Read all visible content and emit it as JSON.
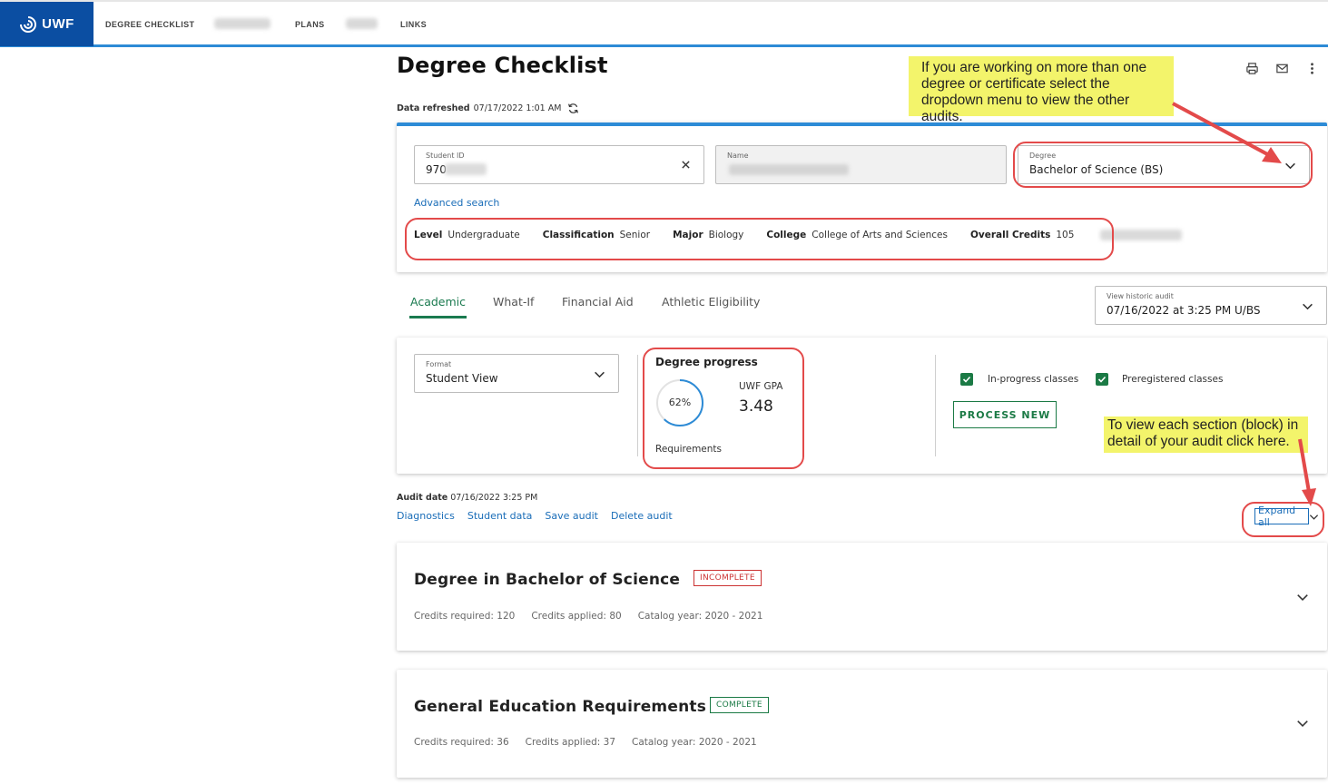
{
  "brand": {
    "logo_text": "UWF",
    "primary": "#0b4ea2",
    "accent": "#2d8bd6",
    "success": "#1b7a45",
    "danger": "#cc3333",
    "annotation": "#e34a4a",
    "callout": "#f3f46b"
  },
  "nav": {
    "items": [
      "DEGREE CHECKLIST",
      "PLANS",
      "LINKS"
    ]
  },
  "page": {
    "title": "Degree Checklist",
    "refreshed_label": "Data refreshed",
    "refreshed_value": "07/17/2022 1:01 AM"
  },
  "callouts": {
    "degree_menu": "If you are working on more than one degree or certificate select the dropdown menu to view the other audits.",
    "expand_all": "To view each section (block) in detail of your audit click here."
  },
  "student": {
    "id_label": "Student ID",
    "id_value": "970",
    "name_label": "Name",
    "degree_label": "Degree",
    "degree_value": "Bachelor of Science (BS)",
    "advanced_search": "Advanced search",
    "info": [
      {
        "label": "Level",
        "value": "Undergraduate"
      },
      {
        "label": "Classification",
        "value": "Senior"
      },
      {
        "label": "Major",
        "value": "Biology"
      },
      {
        "label": "College",
        "value": "College of Arts and Sciences"
      },
      {
        "label": "Overall Credits",
        "value": "105"
      }
    ]
  },
  "tabs": [
    "Academic",
    "What-If",
    "Financial Aid",
    "Athletic Eligibility"
  ],
  "historic": {
    "label": "View historic audit",
    "value": "07/16/2022 at 3:25 PM U/BS"
  },
  "format": {
    "label": "Format",
    "value": "Student View"
  },
  "progress": {
    "title": "Degree progress",
    "percent_label": "62%",
    "percent": 62,
    "requirements_label": "Requirements",
    "gpa_label": "UWF GPA",
    "gpa_value": "3.48"
  },
  "options": {
    "in_progress": "In-progress classes",
    "preregistered": "Preregistered classes",
    "process_button": "PROCESS NEW"
  },
  "audit": {
    "date_label": "Audit date",
    "date_value": "07/16/2022 3:25 PM",
    "links": [
      "Diagnostics",
      "Student data",
      "Save audit",
      "Delete audit"
    ],
    "expand_all": "Expand all"
  },
  "blocks": [
    {
      "title": "Degree in Bachelor of Science",
      "status": "INCOMPLETE",
      "credits_required_label": "Credits required:",
      "credits_required": "120",
      "credits_applied_label": "Credits applied:",
      "credits_applied": "80",
      "catalog_label": "Catalog year:",
      "catalog": "2020 - 2021"
    },
    {
      "title": "General Education Requirements",
      "status": "COMPLETE",
      "credits_required_label": "Credits required:",
      "credits_required": "36",
      "credits_applied_label": "Credits applied:",
      "credits_applied": "37",
      "catalog_label": "Catalog year:",
      "catalog": "2020 - 2021"
    }
  ]
}
